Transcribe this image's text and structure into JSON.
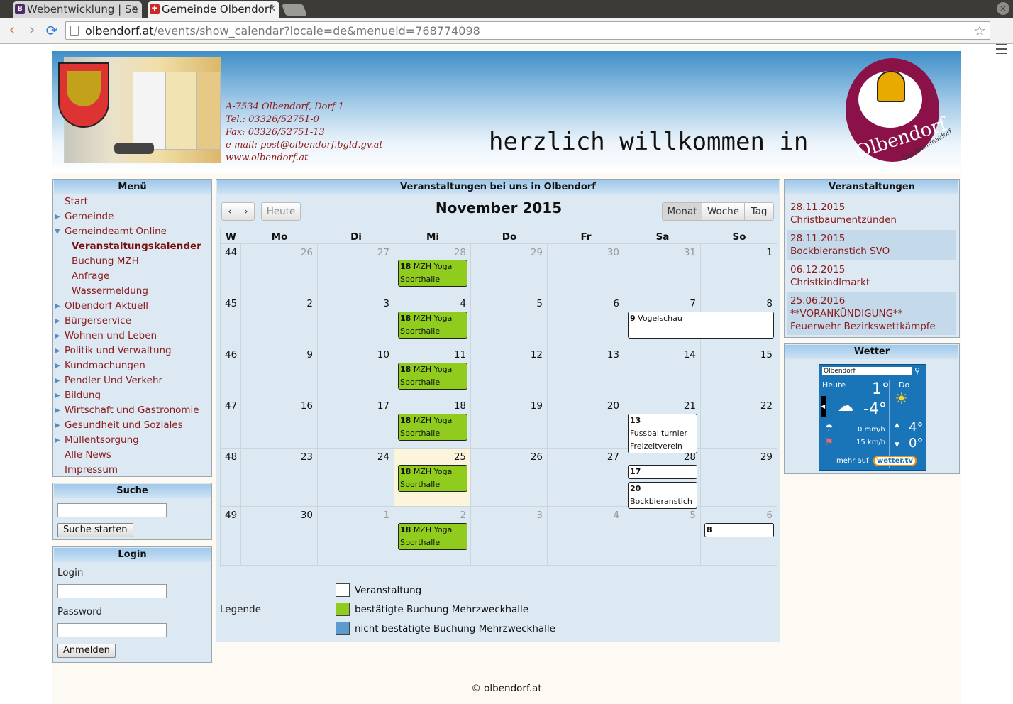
{
  "browser": {
    "tabs": [
      {
        "label": "Webentwicklung | Se",
        "favicon": "B"
      },
      {
        "label": "Gemeinde Olbendorf",
        "favicon": "✚"
      }
    ],
    "url_host": "olbendorf.at",
    "url_path": "/events/show_calendar?locale=de&menueid=768774098"
  },
  "header": {
    "contact": [
      "A-7534 Olbendorf, Dorf 1",
      "Tel.: 03326/52751-0",
      "Fax: 03326/52751-13",
      "e-mail: post@olbendorf.bgld.gv.at",
      "www.olbendorf.at"
    ],
    "welcome": "herzlich willkommen in",
    "logo_name": "Olbendorf",
    "logo_sub": "Das Neunmaldorf"
  },
  "menu": {
    "title": "Menü",
    "items": [
      {
        "label": "Start",
        "arrow": ""
      },
      {
        "label": "Gemeinde",
        "arrow": "▶"
      },
      {
        "label": "Gemeindeamt Online",
        "arrow": "▼"
      },
      {
        "label": "Veranstaltungskalender",
        "arrow": ""
      },
      {
        "label": "Buchung MZH",
        "arrow": ""
      },
      {
        "label": "Anfrage",
        "arrow": ""
      },
      {
        "label": "Wassermeldung",
        "arrow": ""
      },
      {
        "label": "Olbendorf Aktuell",
        "arrow": "▶"
      },
      {
        "label": "Bürgerservice",
        "arrow": "▶"
      },
      {
        "label": "Wohnen und Leben",
        "arrow": "▶"
      },
      {
        "label": "Politik und Verwaltung",
        "arrow": "▶"
      },
      {
        "label": "Kundmachungen",
        "arrow": "▶"
      },
      {
        "label": "Pendler Und Verkehr",
        "arrow": "▶"
      },
      {
        "label": "Bildung",
        "arrow": "▶"
      },
      {
        "label": "Wirtschaft und Gastronomie",
        "arrow": "▶"
      },
      {
        "label": "Gesundheit und Soziales",
        "arrow": "▶"
      },
      {
        "label": "Müllentsorgung",
        "arrow": "▶"
      },
      {
        "label": "Alle News",
        "arrow": ""
      },
      {
        "label": "Impressum",
        "arrow": ""
      }
    ]
  },
  "search": {
    "title": "Suche",
    "button": "Suche starten"
  },
  "login": {
    "title": "Login",
    "login_label": "Login",
    "password_label": "Password",
    "button": "Anmelden"
  },
  "calendar": {
    "panel_title": "Veranstaltungen bei uns in Olbendorf",
    "prev": "‹",
    "next": "›",
    "today": "Heute",
    "title": "November 2015",
    "views": [
      "Monat",
      "Woche",
      "Tag"
    ],
    "headers": [
      "W",
      "Mo",
      "Di",
      "Mi",
      "Do",
      "Fr",
      "Sa",
      "So"
    ],
    "weeks": [
      {
        "wk": "44",
        "days": [
          "26",
          "27",
          "28",
          "29",
          "30",
          "31",
          "1"
        ],
        "other": [
          true,
          true,
          true,
          true,
          true,
          true,
          false
        ]
      },
      {
        "wk": "45",
        "days": [
          "2",
          "3",
          "4",
          "5",
          "6",
          "7",
          "8"
        ],
        "other": [
          false,
          false,
          false,
          false,
          false,
          false,
          false
        ]
      },
      {
        "wk": "46",
        "days": [
          "9",
          "10",
          "11",
          "12",
          "13",
          "14",
          "15"
        ],
        "other": [
          false,
          false,
          false,
          false,
          false,
          false,
          false
        ]
      },
      {
        "wk": "47",
        "days": [
          "16",
          "17",
          "18",
          "19",
          "20",
          "21",
          "22"
        ],
        "other": [
          false,
          false,
          false,
          false,
          false,
          false,
          false
        ]
      },
      {
        "wk": "48",
        "days": [
          "23",
          "24",
          "25",
          "26",
          "27",
          "28",
          "29"
        ],
        "other": [
          false,
          false,
          false,
          false,
          false,
          false,
          false
        ]
      },
      {
        "wk": "49",
        "days": [
          "30",
          "1",
          "2",
          "3",
          "4",
          "5",
          "6"
        ],
        "other": [
          false,
          true,
          true,
          true,
          true,
          true,
          true
        ]
      }
    ],
    "events": [
      {
        "week": 0,
        "day": 2,
        "slot": 0,
        "span": 1,
        "time": "18",
        "text": "MZH Yoga Sporthalle",
        "kind": "green"
      },
      {
        "week": 1,
        "day": 2,
        "slot": 0,
        "span": 1,
        "time": "18",
        "text": "MZH Yoga Sporthalle",
        "kind": "green"
      },
      {
        "week": 1,
        "day": 5,
        "slot": 0,
        "span": 2,
        "time": "9",
        "text": "Vogelschau",
        "kind": "white"
      },
      {
        "week": 2,
        "day": 2,
        "slot": 0,
        "span": 1,
        "time": "18",
        "text": "MZH Yoga Sporthalle",
        "kind": "green"
      },
      {
        "week": 3,
        "day": 2,
        "slot": 0,
        "span": 1,
        "time": "18",
        "text": "MZH Yoga Sporthalle",
        "kind": "green"
      },
      {
        "week": 3,
        "day": 5,
        "slot": 0,
        "span": 1,
        "time": "13",
        "text": "Fussballturnier Freizeitverein Olbendorf",
        "kind": "white",
        "lines": 3
      },
      {
        "week": 4,
        "day": 2,
        "slot": 0,
        "span": 1,
        "time": "18",
        "text": "MZH Yoga Sporthalle",
        "kind": "green"
      },
      {
        "week": 4,
        "day": 5,
        "slot": 0,
        "span": 1,
        "time": "17",
        "text": "Christbaumenzünden",
        "kind": "white",
        "lines": 1
      },
      {
        "week": 4,
        "day": 5,
        "slot": 1,
        "span": 1,
        "time": "20",
        "text": "Bockbieranstich SVO",
        "kind": "white"
      },
      {
        "week": 5,
        "day": 2,
        "slot": 0,
        "span": 1,
        "time": "18",
        "text": "MZH Yoga Sporthalle",
        "kind": "green"
      },
      {
        "week": 5,
        "day": 6,
        "slot": 0,
        "span": 1,
        "time": "8",
        "text": "Christkindlmarkt",
        "kind": "white",
        "lines": 1
      }
    ],
    "today_cell": {
      "week": 4,
      "day": 2
    },
    "legend_label": "Legende",
    "legend": [
      {
        "text": "Veranstaltung",
        "color": "#ffffff"
      },
      {
        "text": "bestätigte Buchung Mehrzweckhalle",
        "color": "#8fcc1e"
      },
      {
        "text": "nicht bestätigte Buchung Mehrzweckhalle",
        "color": "#5b9bd0"
      }
    ]
  },
  "upcoming": {
    "title": "Veranstaltungen",
    "items": [
      {
        "date": "28.11.2015",
        "name": "Christbaumentzünden"
      },
      {
        "date": "28.11.2015",
        "name": "Bockbieranstich SVO"
      },
      {
        "date": "06.12.2015",
        "name": "Christkindlmarkt"
      },
      {
        "date": "25.06.2016",
        "name": "**VORANKÜNDIGUNG** Feuerwehr Bezirkswettkämpfe"
      }
    ]
  },
  "weather": {
    "title": "Wetter",
    "location": "Olbendorf",
    "today_label": "Heute",
    "today_high": "1°",
    "today_low": "-4°",
    "next_label": "Do",
    "next_high": "4°",
    "next_low": "0°",
    "rain": "0 mm/h",
    "wind": "15 km/h",
    "more": "mehr auf",
    "brand": "wetter.tv"
  },
  "footer": "© olbendorf.at"
}
